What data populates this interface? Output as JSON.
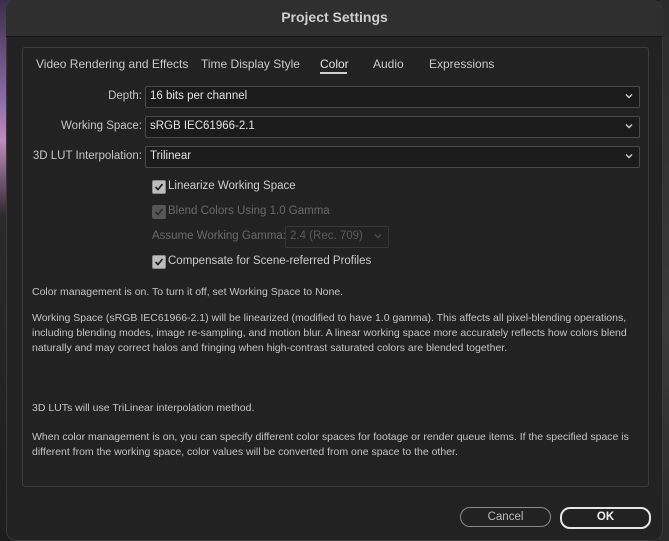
{
  "window": {
    "title": "Project Settings"
  },
  "tabs": [
    {
      "label": "Video Rendering and Effects"
    },
    {
      "label": "Time Display Style"
    },
    {
      "label": "Color",
      "active": true
    },
    {
      "label": "Audio"
    },
    {
      "label": "Expressions"
    }
  ],
  "fields": {
    "depth": {
      "label": "Depth:",
      "value": "16 bits per channel"
    },
    "working_space": {
      "label": "Working Space:",
      "value": "sRGB IEC61966-2.1"
    },
    "lut_interpolation": {
      "label": "3D LUT Interpolation:",
      "value": "Trilinear"
    }
  },
  "options": {
    "linearize": {
      "label": "Linearize Working Space",
      "checked": true,
      "enabled": true
    },
    "blend_gamma": {
      "label": "Blend Colors Using 1.0 Gamma",
      "checked": true,
      "enabled": false
    },
    "assume_gamma": {
      "label": "Assume Working Gamma:",
      "value": "2.4 (Rec. 709)",
      "enabled": false
    },
    "compensate": {
      "label": "Compensate for Scene-referred Profiles",
      "checked": true,
      "enabled": true
    }
  },
  "info": {
    "p1": "Color management is on. To turn it off, set Working Space to None.",
    "p2": "Working Space (sRGB IEC61966-2.1) will be linearized (modified to have 1.0 gamma). This affects all pixel-blending operations, including blending modes, image re-sampling, and motion blur. A linear working space more accurately reflects how colors blend naturally and may correct halos and fringing when high-contrast saturated colors are blended together.",
    "p3": "3D LUTs will use TriLinear interpolation method.",
    "p4": "When color management is on, you can specify different color spaces for footage or render queue items. If the specified space is different from the working space, color values will be converted from one space to the other."
  },
  "buttons": {
    "cancel": "Cancel",
    "ok": "OK"
  },
  "colors": {
    "dialog_bg": "#222222",
    "titlebar_bg": "#2f2f2f",
    "text": "#d6d6d6"
  },
  "icons": {
    "dropdown": "chevron-down-icon",
    "check": "checkmark-icon"
  }
}
